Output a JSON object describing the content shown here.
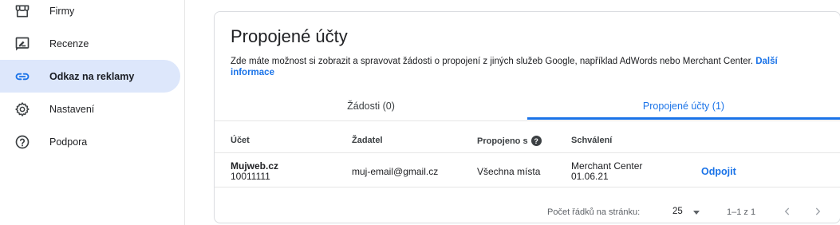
{
  "sidebar": {
    "items": [
      {
        "label": "Firmy",
        "icon": "storefront-icon",
        "active": false
      },
      {
        "label": "Recenze",
        "icon": "rate-review-icon",
        "active": false
      },
      {
        "label": "Odkaz na reklamy",
        "icon": "link-icon",
        "active": true
      },
      {
        "label": "Nastavení",
        "icon": "gear-icon",
        "active": false
      },
      {
        "label": "Podpora",
        "icon": "help-circle-icon",
        "active": false
      }
    ]
  },
  "card": {
    "title": "Propojené účty",
    "description": "Zde máte možnost si zobrazit a spravovat žádosti o propojení z jiných služeb Google, například AdWords nebo Merchant Center.",
    "more_link": "Další informace"
  },
  "tabs": [
    {
      "label": "Žádosti (0)",
      "active": false
    },
    {
      "label": "Propojené účty (1)",
      "active": true
    }
  ],
  "table": {
    "headers": {
      "account": "Účet",
      "requester": "Žadatel",
      "linked_with": "Propojeno s",
      "approval": "Schválení"
    },
    "rows": [
      {
        "account_name": "Mujweb.cz",
        "account_id": "10011111",
        "requester": "muj-email@gmail.cz",
        "linked_with": "Všechna místa",
        "approval_source": "Merchant Center",
        "approval_date": "01.06.21",
        "action": "Odpojit"
      }
    ]
  },
  "pagination": {
    "rows_per_page_label": "Počet řádků na stránku:",
    "rows_per_page": "25",
    "range": "1–1 z 1"
  },
  "colors": {
    "accent": "#1a73e8",
    "active_nav_bg": "#dde7fb"
  }
}
